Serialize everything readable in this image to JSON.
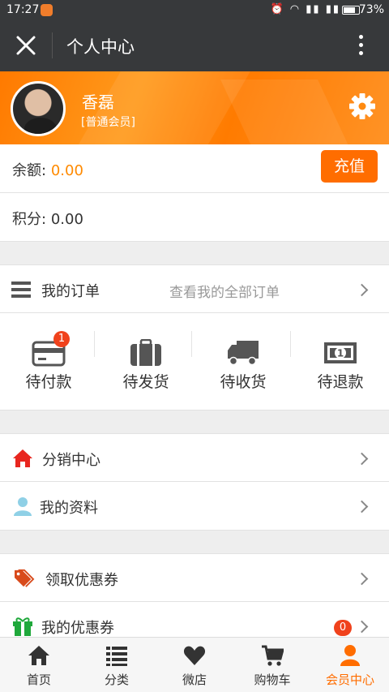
{
  "status_bar": {
    "time": "17:27",
    "battery": "73%"
  },
  "titlebar": {
    "title": "个人中心"
  },
  "profile": {
    "name": "香磊",
    "level": "[普通会员]"
  },
  "balance": {
    "label": "余额:",
    "value": "0.00",
    "recharge_label": "充值"
  },
  "points": {
    "label": "积分:",
    "value": "0.00"
  },
  "orders": {
    "title": "我的订单",
    "view_all": "查看我的全部订单",
    "items": [
      {
        "label": "待付款",
        "icon": "card-icon",
        "badge": "1"
      },
      {
        "label": "待发货",
        "icon": "suitcase-icon"
      },
      {
        "label": "待收货",
        "icon": "truck-icon"
      },
      {
        "label": "待退款",
        "icon": "cash-icon"
      }
    ]
  },
  "menu": {
    "distribution": "分销中心",
    "my_profile": "我的资料",
    "get_coupons": "领取优惠券",
    "my_coupons": "我的优惠券",
    "my_coupons_count": "0"
  },
  "tabbar": {
    "items": [
      {
        "label": "首页",
        "icon": "home-icon"
      },
      {
        "label": "分类",
        "icon": "list-icon"
      },
      {
        "label": "微店",
        "icon": "heart-icon"
      },
      {
        "label": "购物车",
        "icon": "cart-icon"
      },
      {
        "label": "会员中心",
        "icon": "user-icon",
        "active": true
      }
    ]
  },
  "colors": {
    "accent": "#ff6d00",
    "header_dark": "#37393b",
    "badge": "#f0421c"
  }
}
